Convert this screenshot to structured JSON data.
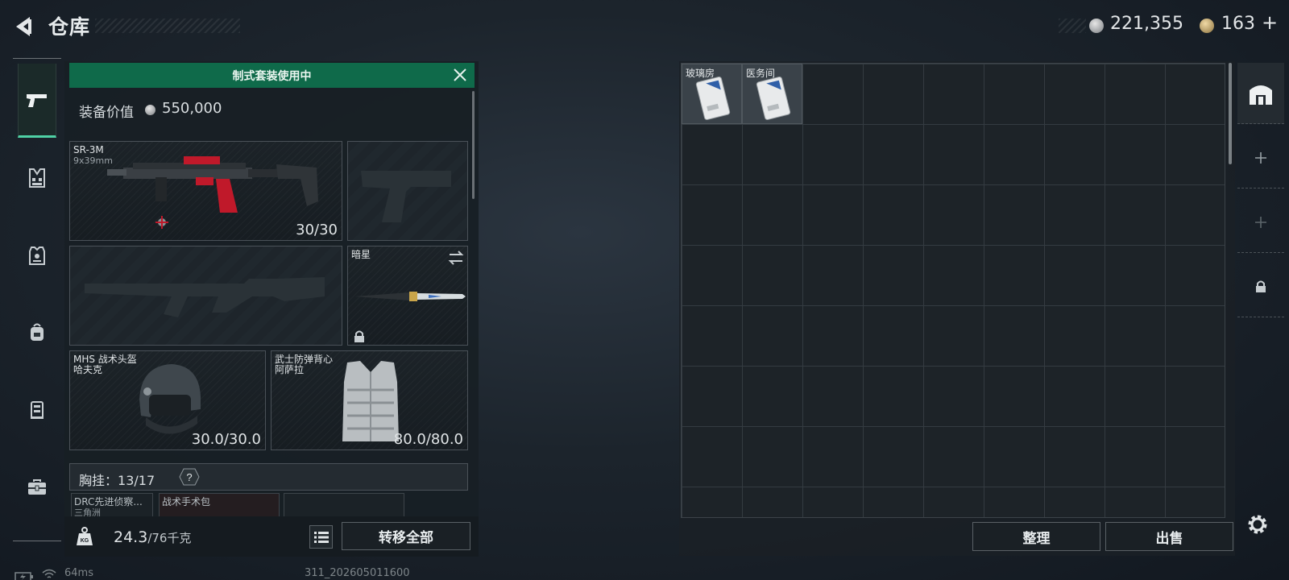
{
  "header": {
    "title": "仓库",
    "currency_1": "221,355",
    "currency_2": "163",
    "currency_2_add": "+"
  },
  "sidebar": {
    "items": [
      {
        "icon": "pistol-icon",
        "active": true
      },
      {
        "icon": "vest-icon",
        "active": false
      },
      {
        "icon": "armor-icon",
        "active": false
      },
      {
        "icon": "backpack-icon",
        "active": false
      },
      {
        "icon": "case-icon",
        "active": false
      },
      {
        "icon": "toolbox-icon",
        "active": false
      }
    ]
  },
  "loadout": {
    "banner": "制式套装使用中",
    "value_label": "装备价值",
    "value_amount": "550,000",
    "primary_weapon": {
      "name": "SR-3M",
      "caliber": "9x39mm",
      "ammo": "30/30"
    },
    "melee": {
      "name": "暗星"
    },
    "helmet": {
      "name": "MHS 战术头盔",
      "sub": "哈夫克",
      "durability": "30.0/30.0"
    },
    "armor": {
      "name": "武士防弹背心",
      "sub": "阿萨拉",
      "durability": "80.0/80.0"
    },
    "chest_rig": {
      "label": "胸挂：",
      "capacity": "13/17",
      "help": "?"
    },
    "mini_slots": [
      {
        "name": "DRC先进侦察...",
        "sub": "三角洲"
      },
      {
        "name": "战术手术包",
        "sub": ""
      }
    ],
    "weight": {
      "current": "24.3",
      "max": "/76千克"
    },
    "transfer_all": "转移全部",
    "weight_icon_label": "KG"
  },
  "storage": {
    "items": [
      {
        "name": "玻璃房"
      },
      {
        "name": "医务间"
      }
    ],
    "organize": "整理",
    "sell": "出售"
  },
  "status_bar": {
    "ping": "64ms",
    "build": "311_202605011600"
  },
  "colors": {
    "accent_green": "#0f6a4a",
    "active_tab_underline": "#4fd1a5",
    "weapon_red": "#c0192a"
  }
}
